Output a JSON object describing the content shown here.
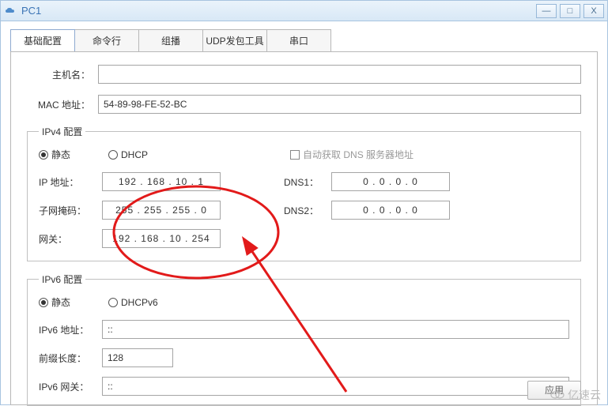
{
  "window": {
    "title": "PC1"
  },
  "tabs": {
    "basic": "基础配置",
    "cmd": "命令行",
    "mcast": "组播",
    "udp": "UDP发包工具",
    "serial": "串口"
  },
  "host": {
    "hostname_label": "主机名：",
    "hostname_value": "",
    "mac_label": "MAC 地址：",
    "mac_value": "54-89-98-FE-52-BC"
  },
  "ipv4": {
    "legend": "IPv4 配置",
    "static_label": "静态",
    "dhcp_label": "DHCP",
    "autodns_label": "自动获取 DNS 服务器地址",
    "ip_label": "IP 地址：",
    "ip_value": "192  .  168  .   10   .    1",
    "mask_label": "子网掩码：",
    "mask_value": "255  .  255  .  255  .   0",
    "gw_label": "网关：",
    "gw_value": "192  .  168  .   10   .  254",
    "dns1_label": "DNS1：",
    "dns1_value": "0    .   0    .   0    .   0",
    "dns2_label": "DNS2：",
    "dns2_value": "0    .   0    .   0    .   0"
  },
  "ipv6": {
    "legend": "IPv6 配置",
    "static_label": "静态",
    "dhcp_label": "DHCPv6",
    "addr_label": "IPv6 地址：",
    "addr_value": "::",
    "prefix_label": "前缀长度：",
    "prefix_value": "128",
    "gw_label": "IPv6 网关：",
    "gw_value": "::"
  },
  "apply_label": "应用",
  "watermark": "亿速云"
}
